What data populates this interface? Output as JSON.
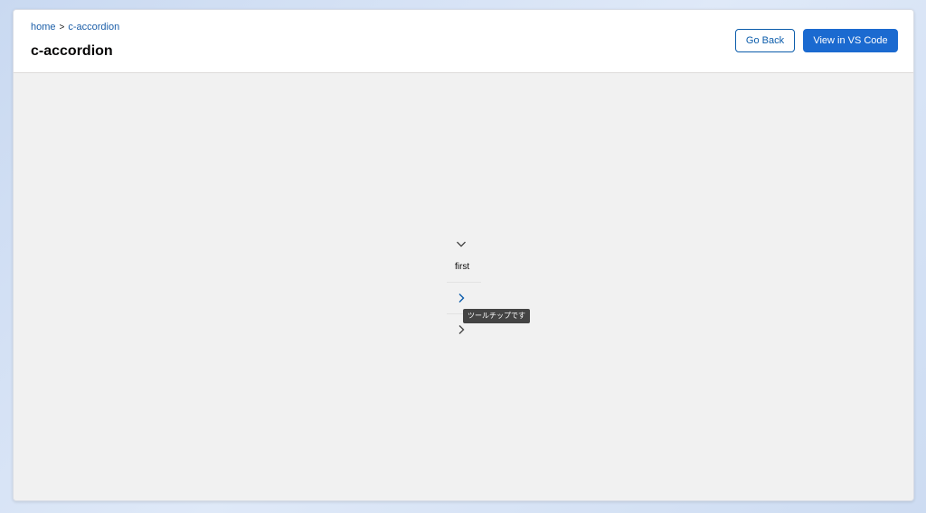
{
  "breadcrumb": {
    "home": "home",
    "separator": ">",
    "current": "c-accordion"
  },
  "header": {
    "title": "c-accordion",
    "go_back_label": "Go Back",
    "view_vscode_label": "View in VS Code"
  },
  "accordion": {
    "sections": [
      {
        "label": "first",
        "expanded": true,
        "icon": "chevron-down-icon"
      },
      {
        "label": "",
        "expanded": false,
        "icon": "chevron-right-icon"
      },
      {
        "label": "",
        "expanded": false,
        "icon": "chevron-right-icon"
      }
    ],
    "tooltip": "ツールチップです"
  },
  "colors": {
    "link": "#1b5ea8",
    "primary_button": "#1b6ad0",
    "tooltip_bg": "#444444"
  }
}
